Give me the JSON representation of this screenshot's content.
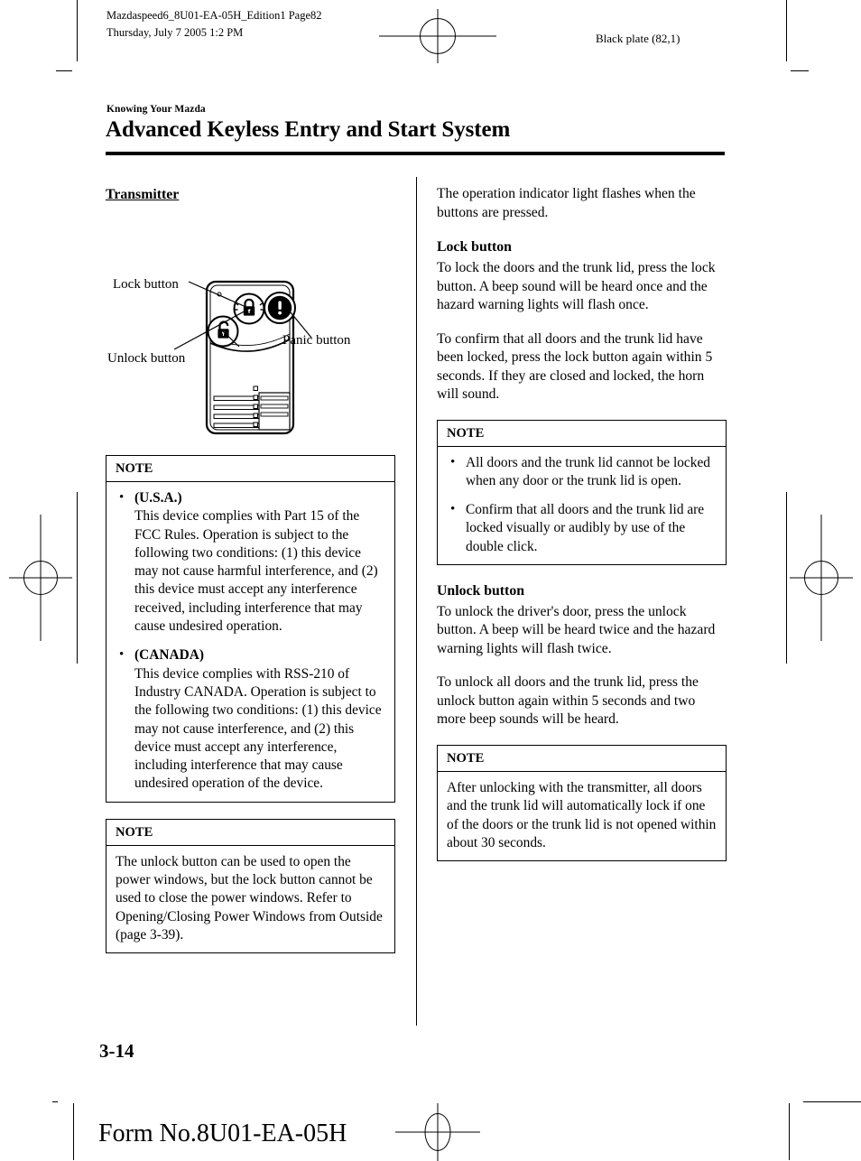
{
  "print_marks": {
    "doc_meta_line1": "Mazdaspeed6_8U01-EA-05H_Edition1 Page82",
    "doc_meta_line2": "Thursday, July 7 2005 1:2 PM",
    "plate_label": "Black plate (82,1)"
  },
  "header": {
    "eyebrow": "Knowing Your Mazda",
    "title": "Advanced Keyless Entry and Start System"
  },
  "left_column": {
    "heading": "Transmitter",
    "figure": {
      "caption_lock": "Lock button",
      "caption_unlock": "Unlock button",
      "caption_panic": "Panic button",
      "icon_lock": "closed-padlock-icon",
      "icon_unlock": "open-padlock-icon",
      "icon_panic": "exclamation-mark-icon"
    },
    "note_regulatory": {
      "title": "NOTE",
      "items": [
        {
          "lead": "(U.S.A.)",
          "text": "This device complies with Part 15 of the FCC Rules. Operation is subject to the following two conditions: (1) this device may not cause harmful interference, and (2) this device must accept any interference received, including interference that may cause undesired operation."
        },
        {
          "lead": "(CANADA)",
          "text": "This device complies with RSS-210 of Industry CANADA. Operation is subject to the following two conditions: (1) this device may not cause interference, and (2) this device must accept any interference, including interference that may cause undesired operation of the device."
        }
      ]
    },
    "note_windows": {
      "title": "NOTE",
      "text": "The unlock button can be used to open the power windows, but the lock button cannot be used to close the power windows. Refer to Opening/Closing Power Windows from Outside (page 3-39)."
    }
  },
  "right_column": {
    "intro": "The operation indicator light flashes when the buttons are pressed.",
    "lock_heading": "Lock button",
    "lock_para1": "To lock the doors and the trunk lid, press the lock button. A beep sound will be heard once and the hazard warning lights will flash once.",
    "lock_para2": "To confirm that all doors and the trunk lid have been locked, press the lock button again within 5 seconds. If they are closed and locked, the horn will sound.",
    "note_lock": {
      "title": "NOTE",
      "items": [
        "All doors and the trunk lid cannot be locked when any door or the trunk lid is open.",
        "Confirm that all doors and the trunk lid are locked visually or audibly by use of the double click."
      ]
    },
    "unlock_heading": "Unlock button",
    "unlock_para1": "To unlock the driver's door, press the unlock button. A beep will be heard twice and the hazard warning lights will flash twice.",
    "unlock_para2": "To unlock all doors and the trunk lid, press the unlock button again within 5 seconds and two more beep sounds will be heard.",
    "note_unlock": {
      "title": "NOTE",
      "text": "After unlocking with the transmitter, all doors and the trunk lid will automatically lock if one of the doors or the trunk lid is not opened within about 30 seconds."
    }
  },
  "footer": {
    "page_number": "3-14",
    "form_number": "Form No.8U01-EA-05H"
  },
  "bullet_glyph": "•"
}
